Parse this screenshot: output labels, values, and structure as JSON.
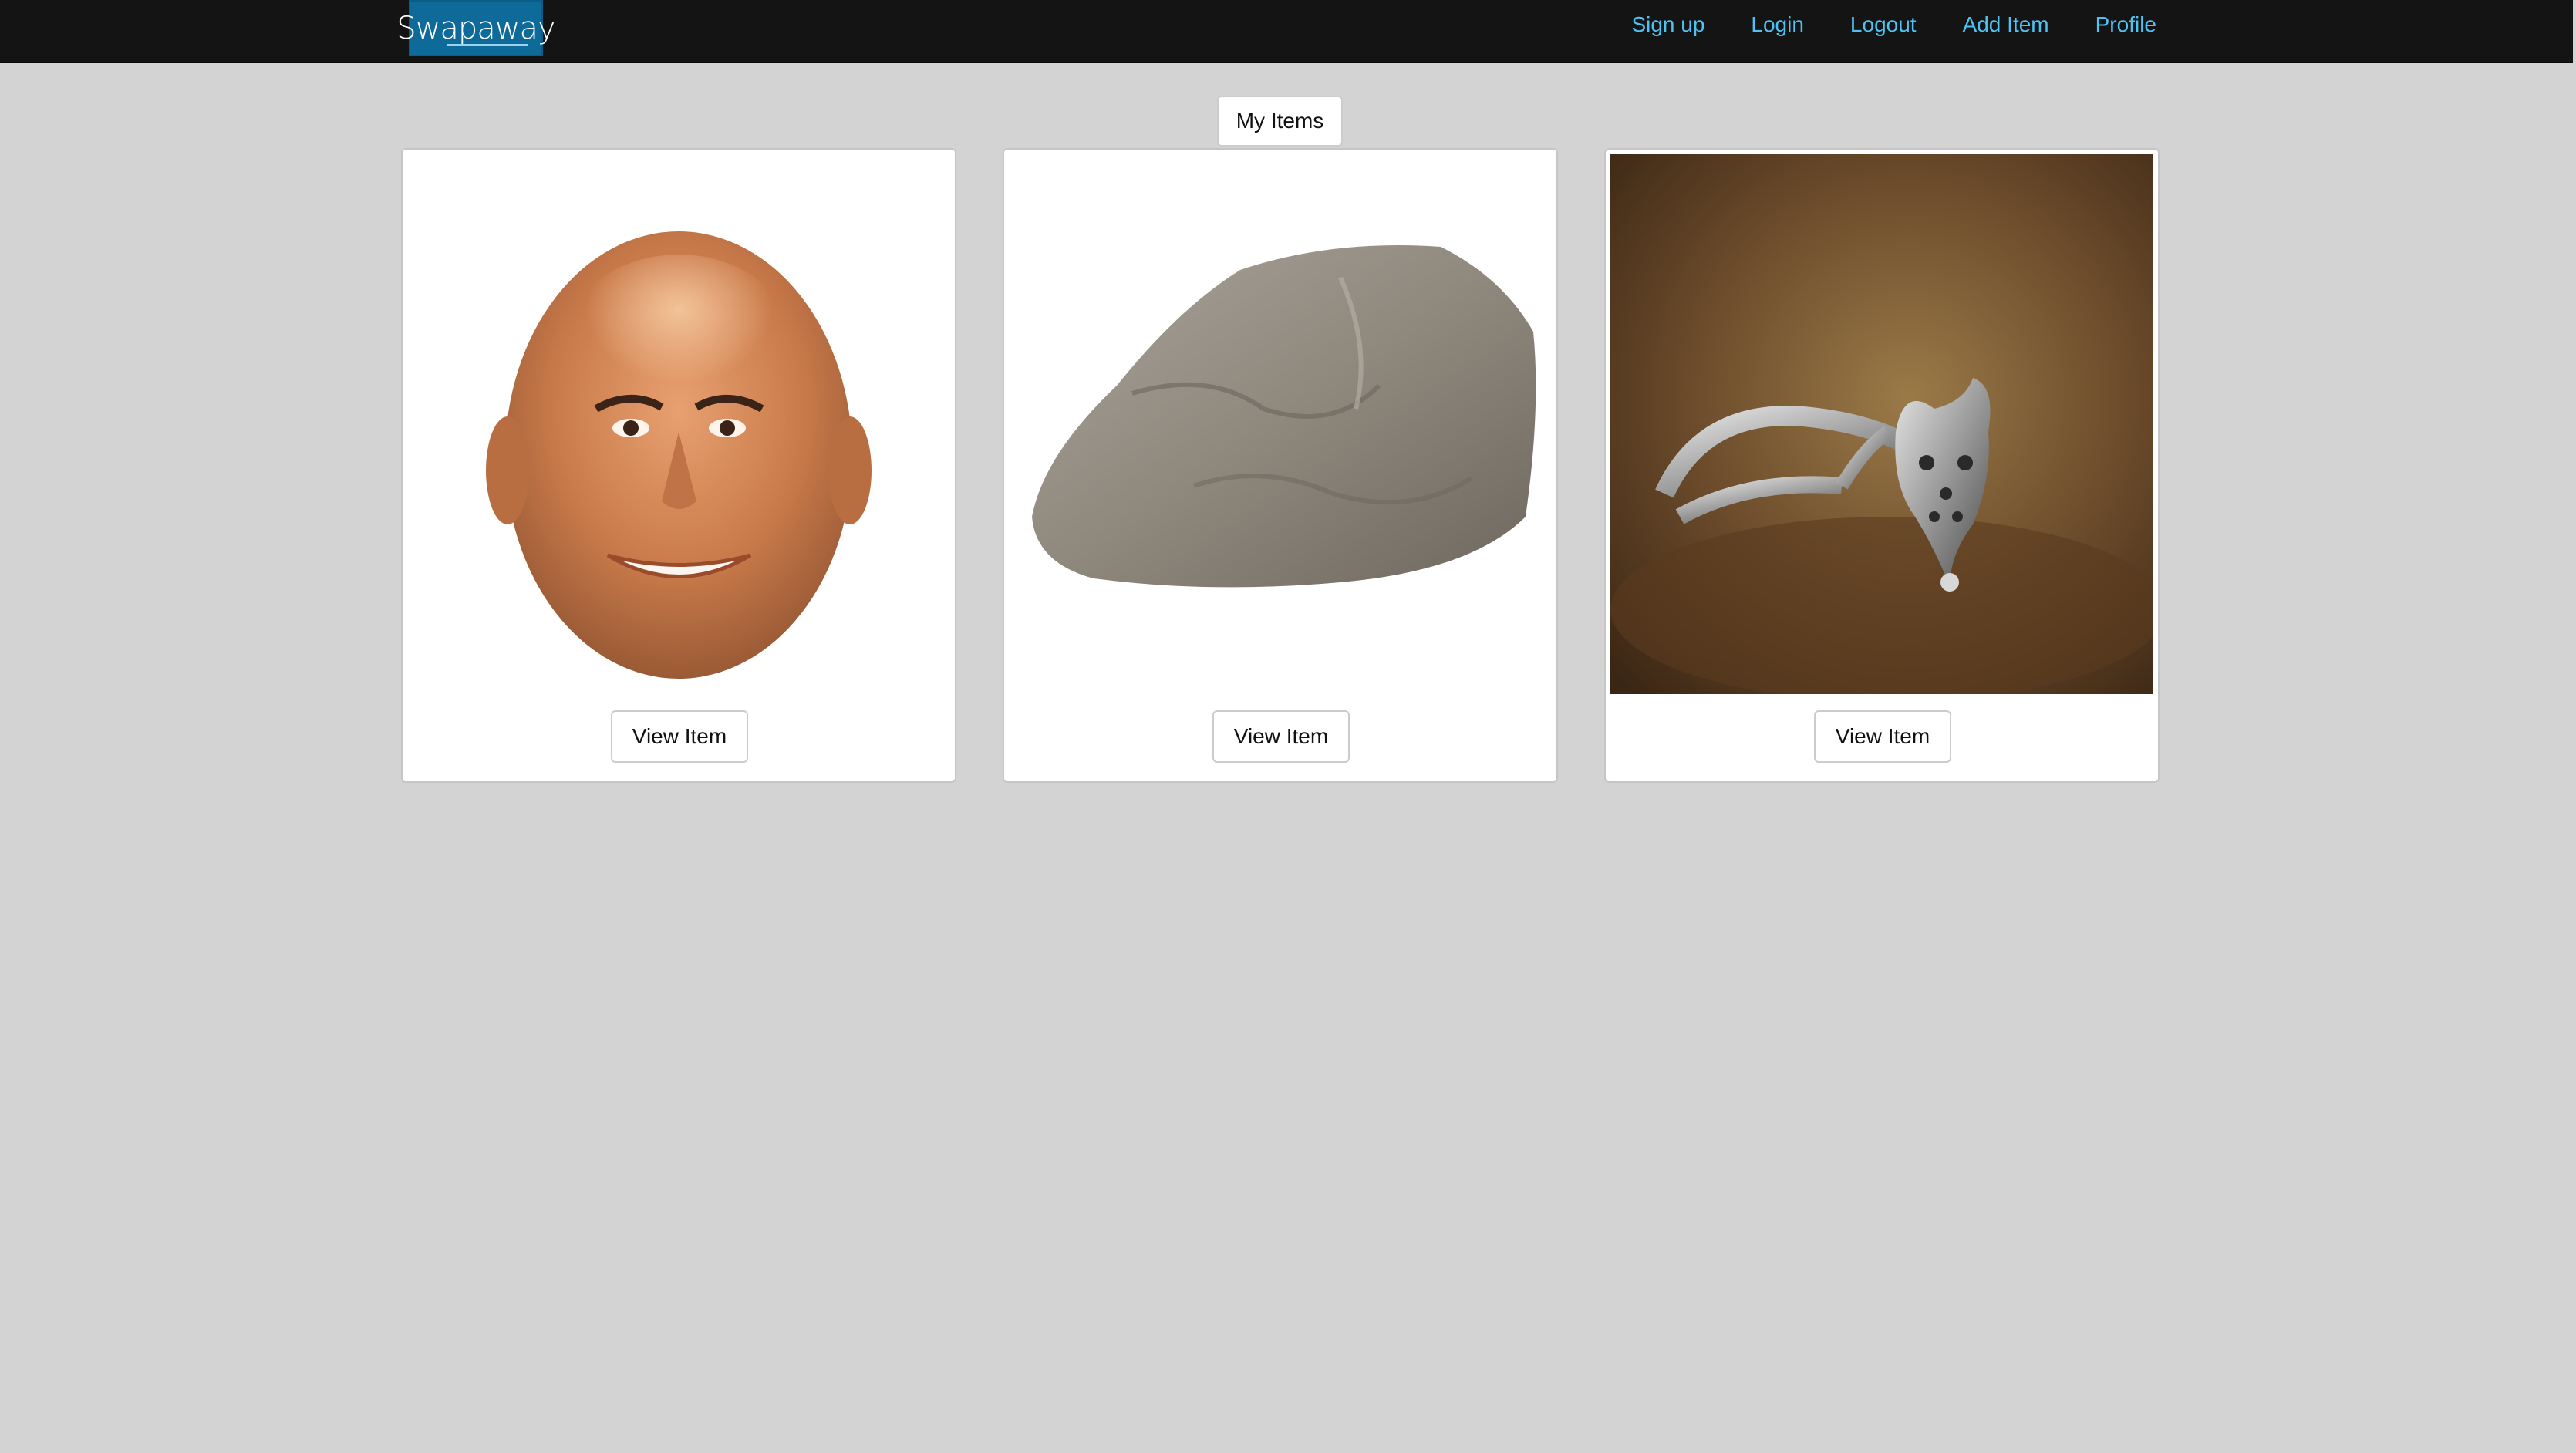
{
  "nav": {
    "logo_text": "Swapaway",
    "links": [
      {
        "label": "Sign up"
      },
      {
        "label": "Login"
      },
      {
        "label": "Logout"
      },
      {
        "label": "Add Item"
      },
      {
        "label": "Profile"
      }
    ],
    "link_color": "#4ec3f3",
    "background": "#141414",
    "logo_color": "#0e6a99"
  },
  "main": {
    "my_items_label": "My Items",
    "background": "#d3d3d3",
    "cards": [
      {
        "image": "face-photo",
        "button_label": "View Item"
      },
      {
        "image": "rock-photo",
        "button_label": "View Item"
      },
      {
        "image": "fox-ring-photo",
        "button_label": "View Item"
      }
    ]
  }
}
